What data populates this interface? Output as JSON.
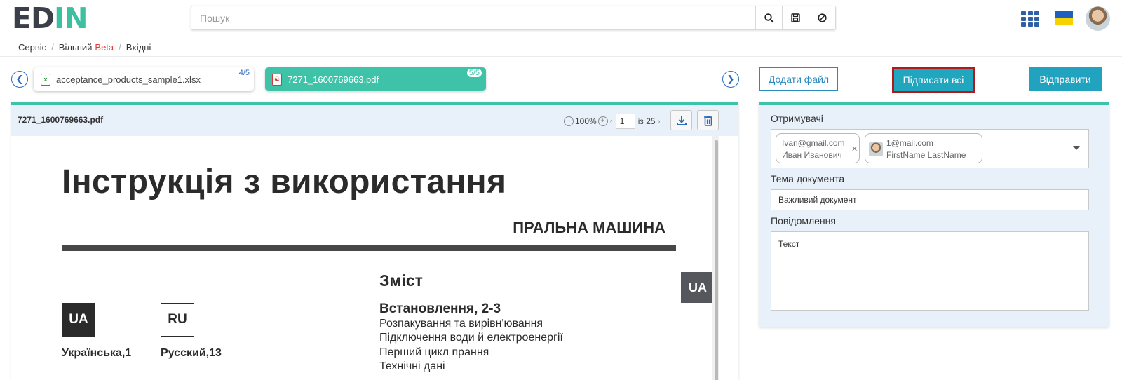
{
  "header": {
    "logo": {
      "part1": "ED",
      "part2": "IN"
    },
    "search": {
      "placeholder": "Пошук"
    },
    "icons": [
      "search-icon",
      "save-icon",
      "clear-icon",
      "apps-grid-icon",
      "ukraine-flag-icon",
      "user-avatar"
    ]
  },
  "breadcrumb": {
    "items": [
      "Сервіс",
      "Вільний",
      "Вхідні"
    ],
    "badge": "Beta"
  },
  "file_tabs": [
    {
      "name": "acceptance_products_sample1.xlsx",
      "counter": "4/5",
      "active": false,
      "icon": "excel-file-icon"
    },
    {
      "name": "7271_1600769663.pdf",
      "counter": "5/5",
      "active": true,
      "icon": "pdf-file-icon"
    }
  ],
  "actions": {
    "add_file": "Додати файл",
    "sign_all": "Підписати всі",
    "send": "Відправити"
  },
  "viewer": {
    "file_name": "7271_1600769663.pdf",
    "zoom": "100%",
    "page": "1",
    "page_total_label": "із 25",
    "document": {
      "title": "Інструкція з використання",
      "subtitle": "ПРАЛЬНА МАШИНА",
      "side_tab": "UA",
      "languages": [
        {
          "code": "UA",
          "label": "Українська,1"
        },
        {
          "code": "RU",
          "label": "Русский,13"
        }
      ],
      "toc_heading": "Зміст",
      "toc_section": "Встановлення, 2-3",
      "toc_items": [
        "Розпакування та вирівн'ювання",
        "Підключення води й електроенергії",
        "Перший цикл прання",
        "Технічні дані"
      ]
    }
  },
  "panel": {
    "recipients_label": "Отримувачі",
    "recipients": [
      {
        "email": "Ivan@gmail.com",
        "name": "Иван Иванович"
      },
      {
        "email": "1@mail.com",
        "name": "FirstName LastName"
      }
    ],
    "subject_label": "Тема документа",
    "subject_value": "Важливий документ",
    "message_label": "Повідомлення",
    "message_value": "Текст"
  },
  "colors": {
    "accent_teal": "#3ec2a8",
    "primary_blue": "#21a6bf",
    "highlight_red": "#b01a1a",
    "beta_red": "#e0393e"
  }
}
